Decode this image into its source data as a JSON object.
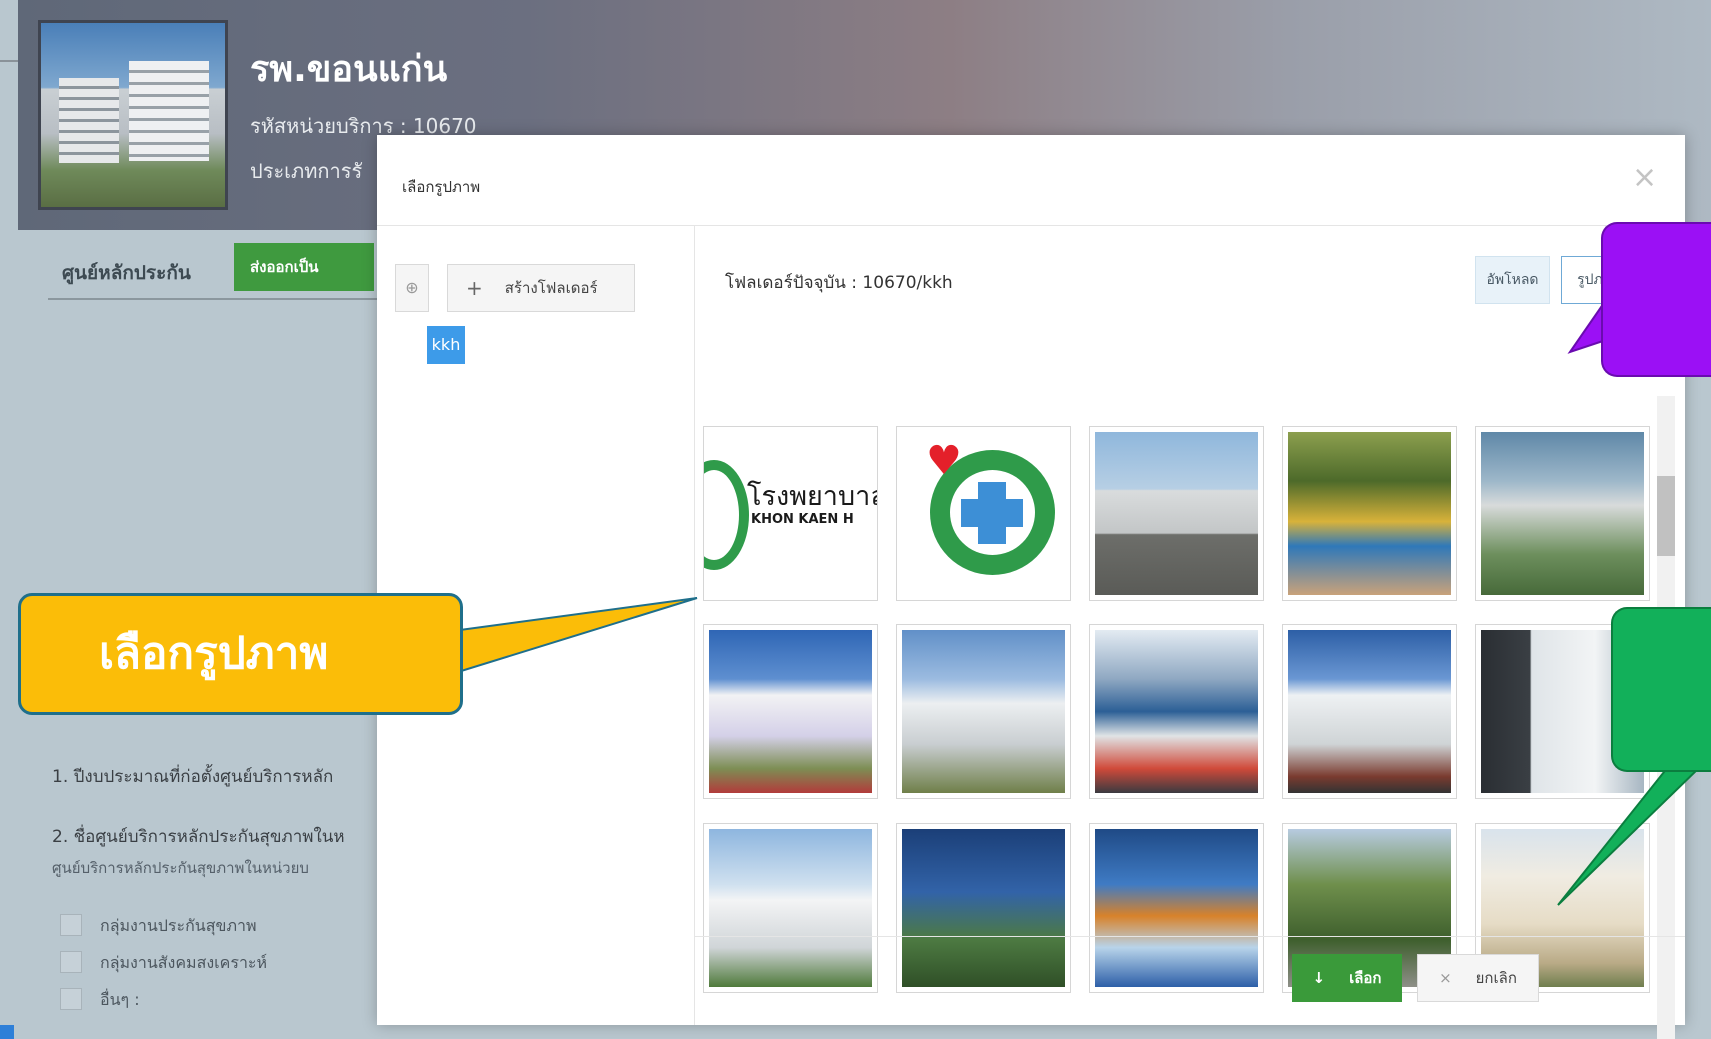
{
  "background": {
    "hospital_name": "รพ.ขอนแก่น",
    "hospital_code": "รหัสหน่วยบริการ : 10670",
    "hospital_type": "ประเภทการรั",
    "tab_label": "ศูนย์หลักประกัน",
    "export_button": "ส่งออกเป็น",
    "question_1": "1. ปีงบประมาณที่ก่อตั้งศูนย์บริการหลัก",
    "question_2": "2. ชื่อศูนย์บริการหลักประกันสุขภาพในห",
    "question_2_sub": "ศูนย์บริการหลักประกันสุขภาพในหน่วยบ",
    "options": [
      "กลุ่มงานประกันสุขภาพ",
      "กลุ่มงานสังคมสงเคราะห์",
      "อื่นๆ :"
    ]
  },
  "modal": {
    "title": "เลือกรูปภาพ",
    "close_glyph": "×",
    "new_folder_label": "สร้างโฟลเดอร์",
    "folder_chip": "kkh",
    "current_folder": "โฟลเดอร์ปัจจุบัน : 10670/kkh",
    "upload_label": "อัพโหลด",
    "image_label": "รูปภาพ",
    "select_label": "เลือก",
    "cancel_label": "ยกเลิก",
    "logo_text_thai": "โรงพยาบาล",
    "logo_text_en": "KHON KAEN H"
  },
  "callouts": {
    "yellow_text": "เลือกรูปภาพ",
    "yellow_color": "#fbbd08",
    "purple_color": "#9b10f5",
    "green_color": "#12b05a"
  },
  "icons": {
    "folder_icon": "folder-icon",
    "plus_icon": "plus-icon",
    "download_icon": "download-icon",
    "close_icon": "close-icon"
  }
}
